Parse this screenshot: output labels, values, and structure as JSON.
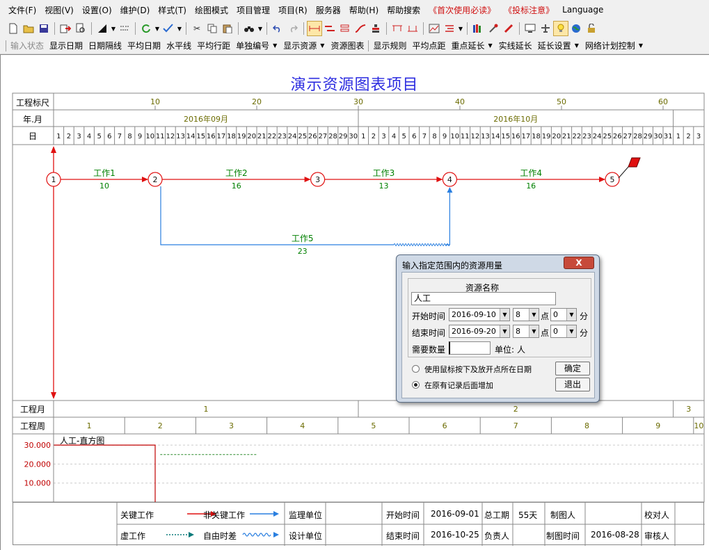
{
  "menu": [
    "文件(F)",
    "视图(V)",
    "设置(O)",
    "维护(D)",
    "样式(T)",
    "绘图模式",
    "项目管理",
    "项目(R)",
    "服务器",
    "帮助(H)",
    "帮助搜索"
  ],
  "menu_red": [
    "《首次使用必读》",
    "《投标注意》"
  ],
  "menu_lang": "Language",
  "toolbar2": {
    "items": [
      {
        "label": "输入状态",
        "disabled": true
      },
      {
        "label": "显示日期"
      },
      {
        "label": "日期隔线"
      },
      {
        "label": "平均日期"
      },
      {
        "label": "水平线"
      },
      {
        "label": "平均行距"
      },
      {
        "label": "单独编号",
        "dropdown": true
      },
      {
        "label": "显示资源",
        "dropdown": true
      },
      {
        "label": "资源图表"
      },
      {
        "sep": true
      },
      {
        "label": "显示规则"
      },
      {
        "label": "平均点距"
      },
      {
        "label": "重点延长",
        "dropdown": true
      },
      {
        "label": "实线延长"
      },
      {
        "label": "延长设置",
        "dropdown": true
      },
      {
        "label": "网络计划控制",
        "dropdown": true
      }
    ]
  },
  "project_title": "演示资源图表项目",
  "ruler": {
    "label": "工程标尺",
    "ticks": [
      "10",
      "20",
      "30",
      "40",
      "50",
      "60"
    ]
  },
  "yearmonth": {
    "label": "年.月",
    "months": [
      "2016年09月",
      "2016年10月"
    ]
  },
  "days": {
    "label": "日",
    "sep_days": [
      "1",
      "2",
      "3",
      "4",
      "5",
      "6",
      "7",
      "8",
      "9",
      "10",
      "11",
      "12",
      "13",
      "14",
      "15",
      "16",
      "17",
      "18",
      "19",
      "20",
      "21",
      "22",
      "23",
      "24",
      "25",
      "26",
      "27",
      "28",
      "29",
      "30"
    ],
    "oct_days": [
      "1",
      "2",
      "3",
      "4",
      "5",
      "6",
      "7",
      "8",
      "9",
      "10",
      "11",
      "12",
      "13",
      "14",
      "15",
      "16",
      "17",
      "18",
      "19",
      "20",
      "21",
      "22",
      "23",
      "24",
      "25",
      "26",
      "27",
      "28",
      "29",
      "30",
      "31"
    ],
    "nov_days": [
      "1",
      "2",
      "3"
    ]
  },
  "network": {
    "nodes": [
      "1",
      "2",
      "3",
      "4",
      "5"
    ],
    "works": [
      {
        "name": "工作1",
        "duration": "10"
      },
      {
        "name": "工作2",
        "duration": "16"
      },
      {
        "name": "工作3",
        "duration": "13"
      },
      {
        "name": "工作4",
        "duration": "16"
      },
      {
        "name": "工作5",
        "duration": "23"
      }
    ]
  },
  "engmonth": {
    "label": "工程月",
    "values": [
      "1",
      "2",
      "3"
    ]
  },
  "engweek": {
    "label": "工程周",
    "values": [
      "1",
      "2",
      "3",
      "4",
      "5",
      "6",
      "7",
      "8",
      "9",
      "10"
    ]
  },
  "histogram": {
    "title": "人工-直方图",
    "yticks": [
      "30.000",
      "20.000",
      "10.000"
    ],
    "level": 30,
    "level_days": 10,
    "dashed_level": 25
  },
  "legend": {
    "critical": "关键工作",
    "noncritical": "非关键工作",
    "virtual": "虚工作",
    "freefloat": "自由时差",
    "supervisor": "监理单位",
    "designer": "设计单位",
    "start_label": "开始时间",
    "start_value": "2016-09-01",
    "end_label": "结束时间",
    "end_value": "2016-10-25",
    "total_label": "总工期",
    "total_value": "55天",
    "owner_label": "负责人",
    "drawer_label": "制图人",
    "draw_time_label": "制图时间",
    "draw_time_value": "2016-08-28",
    "checker_label": "校对人",
    "reviewer_label": "审核人"
  },
  "dialog": {
    "title": "输入指定范围内的资源用量",
    "close": "X",
    "resource_name_label": "资源名称",
    "resource_name_value": "人工",
    "start_label": "开始时间",
    "start_date": "2016-09-10",
    "start_hour": "8",
    "start_min": "0",
    "end_label": "结束时间",
    "end_date": "2016-09-20",
    "end_hour": "8",
    "end_min": "0",
    "point": "点",
    "minute": "分",
    "qty_label": "需要数量",
    "qty_value": "",
    "unit_label": "单位:",
    "unit_value": "人",
    "radio1": "使用鼠标按下及放开点所在日期",
    "radio2": "在原有记录后面增加",
    "ok": "确定",
    "exit": "退出"
  },
  "colors": {
    "critical": "#e01010",
    "noncritical": "#2a7fe0",
    "green": "#008000",
    "title_blue": "#2d2de0",
    "olive": "#6b6b00",
    "axis_red": "#c00000"
  }
}
